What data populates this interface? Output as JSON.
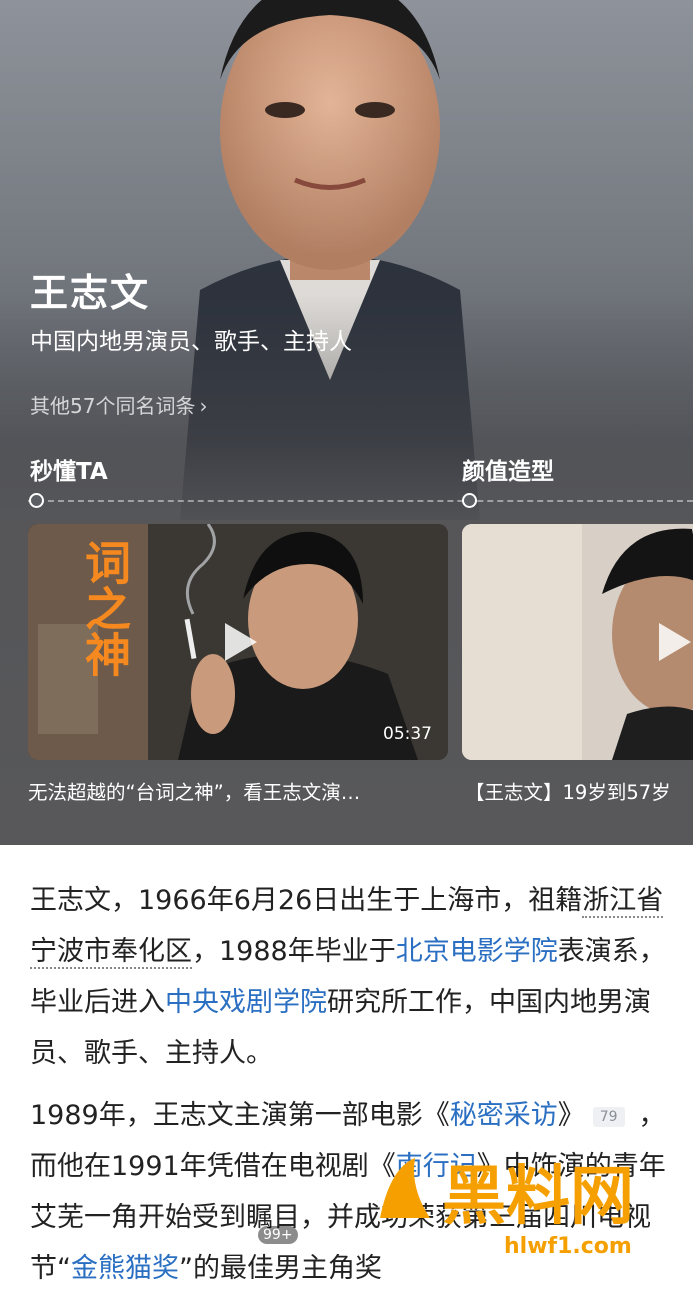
{
  "hero": {
    "name": "王志文",
    "subtitle": "中国内地男演员、歌手、主持人",
    "same_name": "其他57个同名词条",
    "sections": [
      "秒懂TA",
      "颜值造型"
    ]
  },
  "videos": [
    {
      "overlay_text": "台词之神",
      "duration": "05:37",
      "caption": "无法超越的“台词之神”，看王志文演…"
    },
    {
      "caption": "【王志文】19岁到57岁"
    }
  ],
  "article": {
    "p1": {
      "a": "王志文，1966年6月26日出生于上海市，祖籍",
      "b": "浙江省宁波市奉化区",
      "c": "，1988年毕业于",
      "d": "北京电影学院",
      "e": "表演系，毕业后进入",
      "f": "中央戏剧学院",
      "g": "研究所工作，中国内地男演员、歌手、主持人。"
    },
    "p2": {
      "a": "1989年，王志文主演第一部电影《",
      "b": "秘密采访",
      "c": "》",
      "ref": "79",
      "d": "，而他在1991年凭借在电视剧《",
      "e": "南行记",
      "f": "》中饰演的青年艾芜一角开始受到瞩目，并成功荣获第三届四川电视节",
      "g": "“",
      "h": "金熊猫奖",
      "i": "”的最佳男主角奖"
    }
  },
  "watermark": {
    "brand": "黑料网",
    "url": "hlwf1.com",
    "badge": "99+"
  },
  "colors": {
    "link": "#2b6fc2",
    "watermark": "#f5a000"
  }
}
